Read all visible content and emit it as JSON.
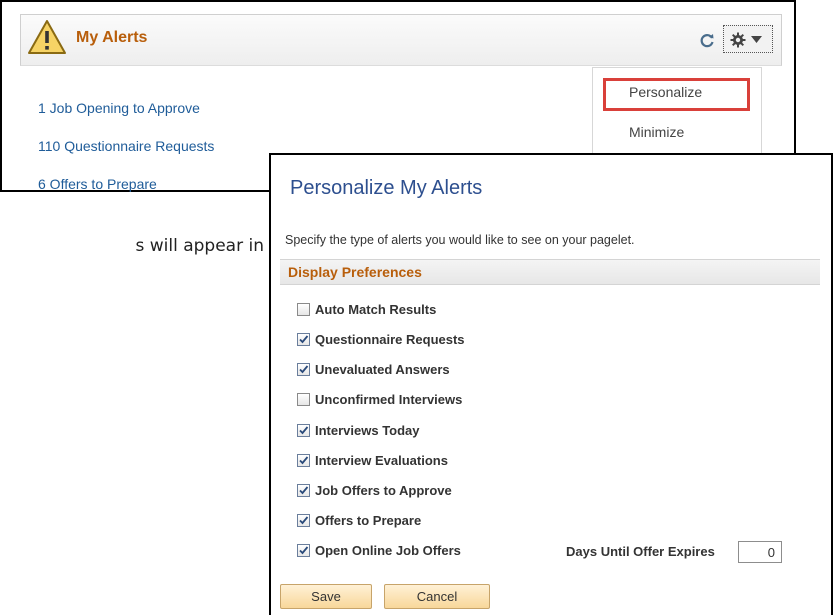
{
  "background": {
    "text": "s will appear in"
  },
  "pagelet": {
    "title": "My Alerts",
    "alerts": [
      "1 Job Opening to Approve",
      "110 Questionnaire Requests",
      "6 Offers to Prepare"
    ]
  },
  "menu": {
    "items": [
      "Personalize",
      "Minimize"
    ]
  },
  "modal": {
    "title": "Personalize My Alerts",
    "description": "Specify the type of alerts you would like to see on your pagelet.",
    "section_title": "Display Preferences",
    "preferences": [
      {
        "label": "Auto Match Results",
        "checked": false
      },
      {
        "label": "Questionnaire Requests",
        "checked": true
      },
      {
        "label": "Unevaluated Answers",
        "checked": true
      },
      {
        "label": "Unconfirmed Interviews",
        "checked": false
      },
      {
        "label": "Interviews Today",
        "checked": true
      },
      {
        "label": "Interview Evaluations",
        "checked": true
      },
      {
        "label": "Job Offers to Approve",
        "checked": true
      },
      {
        "label": "Offers to Prepare",
        "checked": true
      },
      {
        "label": "Open Online Job Offers",
        "checked": true
      }
    ],
    "days_label": "Days Until Offer Expires",
    "days_value": "0",
    "save_label": "Save",
    "cancel_label": "Cancel"
  },
  "colors": {
    "title_orange": "#b85e0b",
    "link_blue": "#1f5c99",
    "modal_title_blue": "#2d4f8f",
    "highlight_red": "#d9403a",
    "button_gold": "#f8d79a"
  }
}
